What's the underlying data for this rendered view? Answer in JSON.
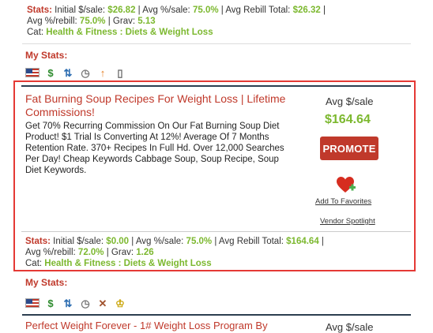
{
  "top_listing": {
    "stats": {
      "initial_label": "Stats:",
      "initial_text": "Initial $/sale:",
      "initial_value": "$26.82",
      "avg_pct_text": "Avg %/sale:",
      "avg_pct_value": "75.0%",
      "rebill_text": "Avg Rebill Total:",
      "rebill_value": "$26.32",
      "rebill_pct_text": "Avg %/rebill:",
      "rebill_pct_value": "75.0%",
      "grav_text": "Grav:",
      "grav_value": "5.13",
      "cat_text": "Cat:",
      "cat_value": "Health & Fitness : Diets & Weight Loss"
    },
    "my_stats": "My Stats:",
    "icons": [
      "us-flag-icon",
      "dollar-icon",
      "transfer-icon",
      "clock-icon",
      "arrow-up-icon",
      "document-icon"
    ]
  },
  "listing": {
    "title": "Fat Burning Soup Recipes For Weight Loss | Lifetime Commissions!",
    "description": "Get 70% Recurring Commission On Our Fat Burning Soup Diet Product! $1 Trial Is Converting At 12%! Average Of 7 Months Retention Rate. 370+ Recipes In Full Hd. Over 12,000 Searches Per Day! Cheap Keywords Cabbage Soup, Soup Recipe, Soup Diet Keywords.",
    "avg_label": "Avg $/sale",
    "avg_value": "$164.64",
    "promote_label": "PROMOTE",
    "favorites_label": "Add To Favorites",
    "vendor_label": "Vendor Spotlight",
    "stats": {
      "initial_label": "Stats:",
      "initial_text": "Initial $/sale:",
      "initial_value": "$0.00",
      "avg_pct_text": "Avg %/sale:",
      "avg_pct_value": "75.0%",
      "rebill_text": "Avg Rebill Total:",
      "rebill_value": "$164.64",
      "rebill_pct_text": "Avg %/rebill:",
      "rebill_pct_value": "72.0%",
      "grav_text": "Grav:",
      "grav_value": "1.26",
      "cat_text": "Cat:",
      "cat_value": "Health & Fitness : Diets & Weight Loss"
    },
    "my_stats": "My Stats:",
    "icons": [
      "us-flag-icon",
      "dollar-icon",
      "transfer-icon",
      "clock-icon",
      "tools-icon",
      "trophy-icon"
    ]
  },
  "next_listing": {
    "title": "Perfect Weight Forever - 1# Weight Loss Program By",
    "avg_label": "Avg $/sale"
  },
  "colors": {
    "accent_red": "#c0392b",
    "value_green": "#7cb82f",
    "highlight_border": "#e53935"
  }
}
